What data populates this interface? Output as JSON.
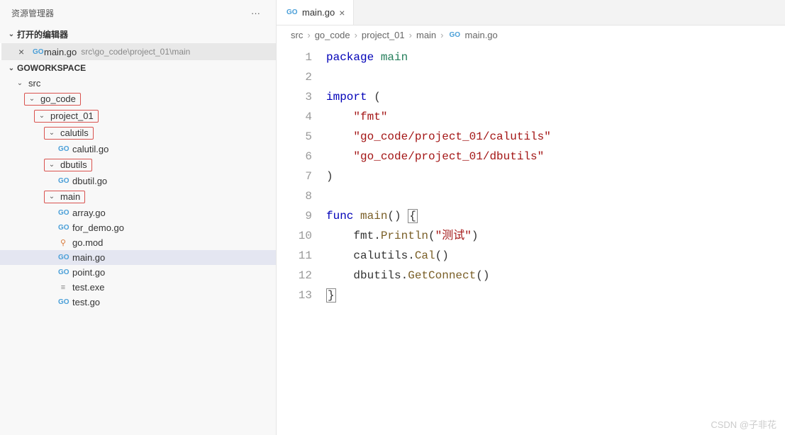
{
  "sidebar": {
    "title": "资源管理器",
    "sections": {
      "openEditors": {
        "label": "打开的编辑器",
        "item": {
          "name": "main.go",
          "path": "src\\go_code\\project_01\\main"
        }
      },
      "workspace": {
        "label": "GOWORKSPACE"
      }
    },
    "tree": {
      "src": "src",
      "go_code": "go_code",
      "project_01": "project_01",
      "calutils": "calutils",
      "calutil_go": "calutil.go",
      "dbutils": "dbutils",
      "dbutil_go": "dbutil.go",
      "main": "main",
      "array_go": "array.go",
      "for_demo_go": "for_demo.go",
      "go_mod": "go.mod",
      "main_go": "main.go",
      "point_go": "point.go",
      "test_exe": "test.exe",
      "test_go": "test.go"
    }
  },
  "tab": {
    "name": "main.go"
  },
  "breadcrumb": {
    "p1": "src",
    "p2": "go_code",
    "p3": "project_01",
    "p4": "main",
    "p5": "main.go"
  },
  "code": {
    "l1_kw": "package",
    "l1_pkg": " main",
    "l3_kw": "import",
    "l3_rest": " (",
    "l4": "    \"fmt\"",
    "l5": "    \"go_code/project_01/calutils\"",
    "l6": "    \"go_code/project_01/dbutils\"",
    "l7": ")",
    "l9_kw": "func",
    "l9_fn": " main",
    "l9_rest": "() ",
    "l9_brace": "{",
    "l10_a": "    fmt.",
    "l10_fn": "Println",
    "l10_b": "(",
    "l10_str": "\"测试\"",
    "l10_c": ")",
    "l11_a": "    calutils.",
    "l11_fn": "Cal",
    "l11_b": "()",
    "l12_a": "    dbutils.",
    "l12_fn": "GetConnect",
    "l12_b": "()",
    "l13": "}"
  },
  "lineNumbers": [
    "1",
    "2",
    "3",
    "4",
    "5",
    "6",
    "7",
    "8",
    "9",
    "10",
    "11",
    "12",
    "13"
  ],
  "watermark": "CSDN @子非花"
}
